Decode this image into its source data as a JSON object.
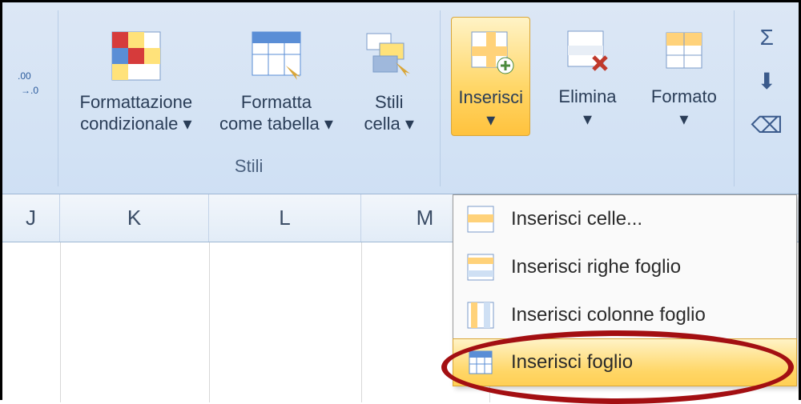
{
  "ribbon": {
    "number_group": {
      "decrease_decimal": ".00→.0"
    },
    "styles_group": {
      "label": "Stili",
      "conditional_formatting": "Formattazione\ncondizionale ▾",
      "format_as_table": "Formatta\ncome tabella ▾",
      "cell_styles": "Stili\ncella ▾"
    },
    "cells_group": {
      "insert": "Inserisci\n▾",
      "delete": "Elimina\n▾",
      "format": "Formato\n▾"
    },
    "editing_group": {
      "autosum": "Σ",
      "fill": "⬇",
      "clear": "⌫"
    }
  },
  "columns": [
    "J",
    "K",
    "L",
    "M"
  ],
  "insert_menu": {
    "items": [
      {
        "id": "insert-cells",
        "label": "Inserisci celle..."
      },
      {
        "id": "insert-rows",
        "label": "Inserisci righe foglio"
      },
      {
        "id": "insert-columns",
        "label": "Inserisci colonne foglio"
      },
      {
        "id": "insert-sheet",
        "label": "Inserisci foglio"
      }
    ],
    "hovered": "insert-sheet"
  }
}
